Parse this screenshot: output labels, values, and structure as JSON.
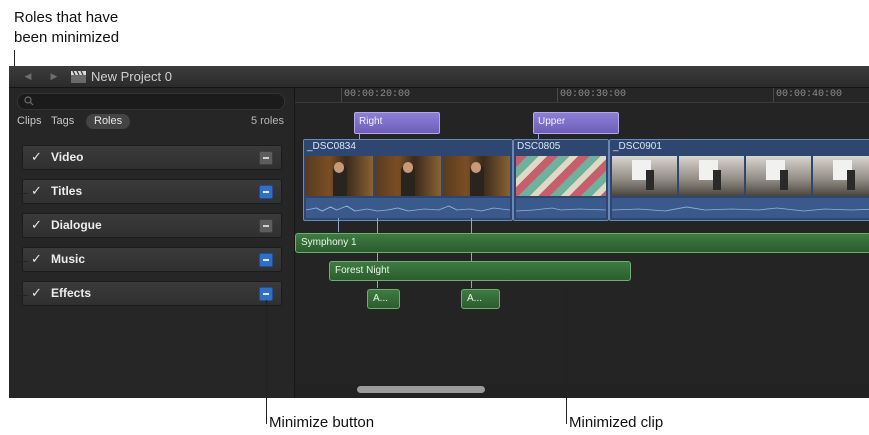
{
  "callouts": {
    "roles_minimized_line1": "Roles that have",
    "roles_minimized_line2": "been minimized",
    "minimize_button": "Minimize button",
    "minimized_clip": "Minimized clip"
  },
  "window": {
    "project_title": "New Project 0",
    "back_icon": "back-arrow-icon",
    "forward_icon": "forward-arrow-icon",
    "project_icon": "clapper-icon"
  },
  "index": {
    "search_placeholder": "",
    "tabs": [
      {
        "label": "Clips"
      },
      {
        "label": "Tags"
      },
      {
        "label": "Roles"
      }
    ],
    "active_tab": "Roles",
    "roles_count": "5 roles",
    "roles": [
      {
        "label": "Video",
        "checked": true,
        "minimized": false
      },
      {
        "label": "Titles",
        "checked": true,
        "minimized": true
      },
      {
        "label": "Dialogue",
        "checked": true,
        "minimized": false
      },
      {
        "label": "Music",
        "checked": true,
        "minimized": true
      },
      {
        "label": "Effects",
        "checked": true,
        "minimized": true
      }
    ],
    "check_glyph": "✓"
  },
  "timeline": {
    "timecodes": [
      "00:00:20:00",
      "00:00:30:00",
      "00:00:40:00"
    ],
    "title_clips": [
      {
        "label": "Right"
      },
      {
        "label": "Upper"
      }
    ],
    "video_clips": [
      {
        "label": "_DSC0834"
      },
      {
        "label": "DSC0805"
      },
      {
        "label": "_DSC0901"
      }
    ],
    "audio_clips": [
      {
        "label": "Symphony 1"
      },
      {
        "label": "Forest Night"
      },
      {
        "label": "A..."
      },
      {
        "label": "A..."
      }
    ]
  },
  "colors": {
    "title_clip": "#7a6bc6",
    "video_clip": "#2e4670",
    "audio_clip": "#3a733d",
    "minimize_active": "#2f6fc7"
  }
}
